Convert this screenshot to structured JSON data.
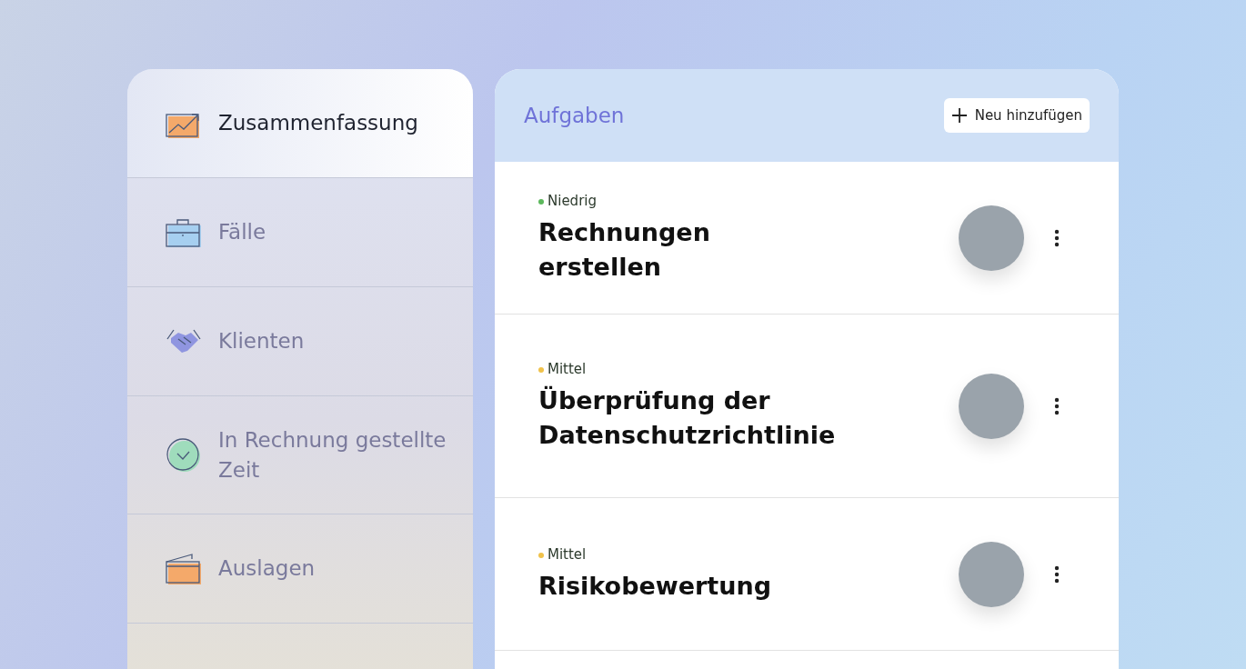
{
  "sidebar": {
    "items": [
      {
        "label": "Zusammenfassung",
        "selected": true
      },
      {
        "label": "Fälle",
        "selected": false
      },
      {
        "label": "Klienten",
        "selected": false
      },
      {
        "label": "In Rechnung gestellte Zeit",
        "selected": false
      },
      {
        "label": "Auslagen",
        "selected": false
      }
    ]
  },
  "tasks": {
    "title": "Aufgaben",
    "add_button": "Neu hinzufügen",
    "rows": [
      {
        "priority": "Niedrig",
        "color": "#5cb85c",
        "title": "Rechnungen erstellen"
      },
      {
        "priority": "Mittel",
        "color": "#f0c24b",
        "title": "Überprüfung der Datenschutzrichtlinie"
      },
      {
        "priority": "Mittel",
        "color": "#f0c24b",
        "title": "Risikobewertung"
      }
    ]
  }
}
